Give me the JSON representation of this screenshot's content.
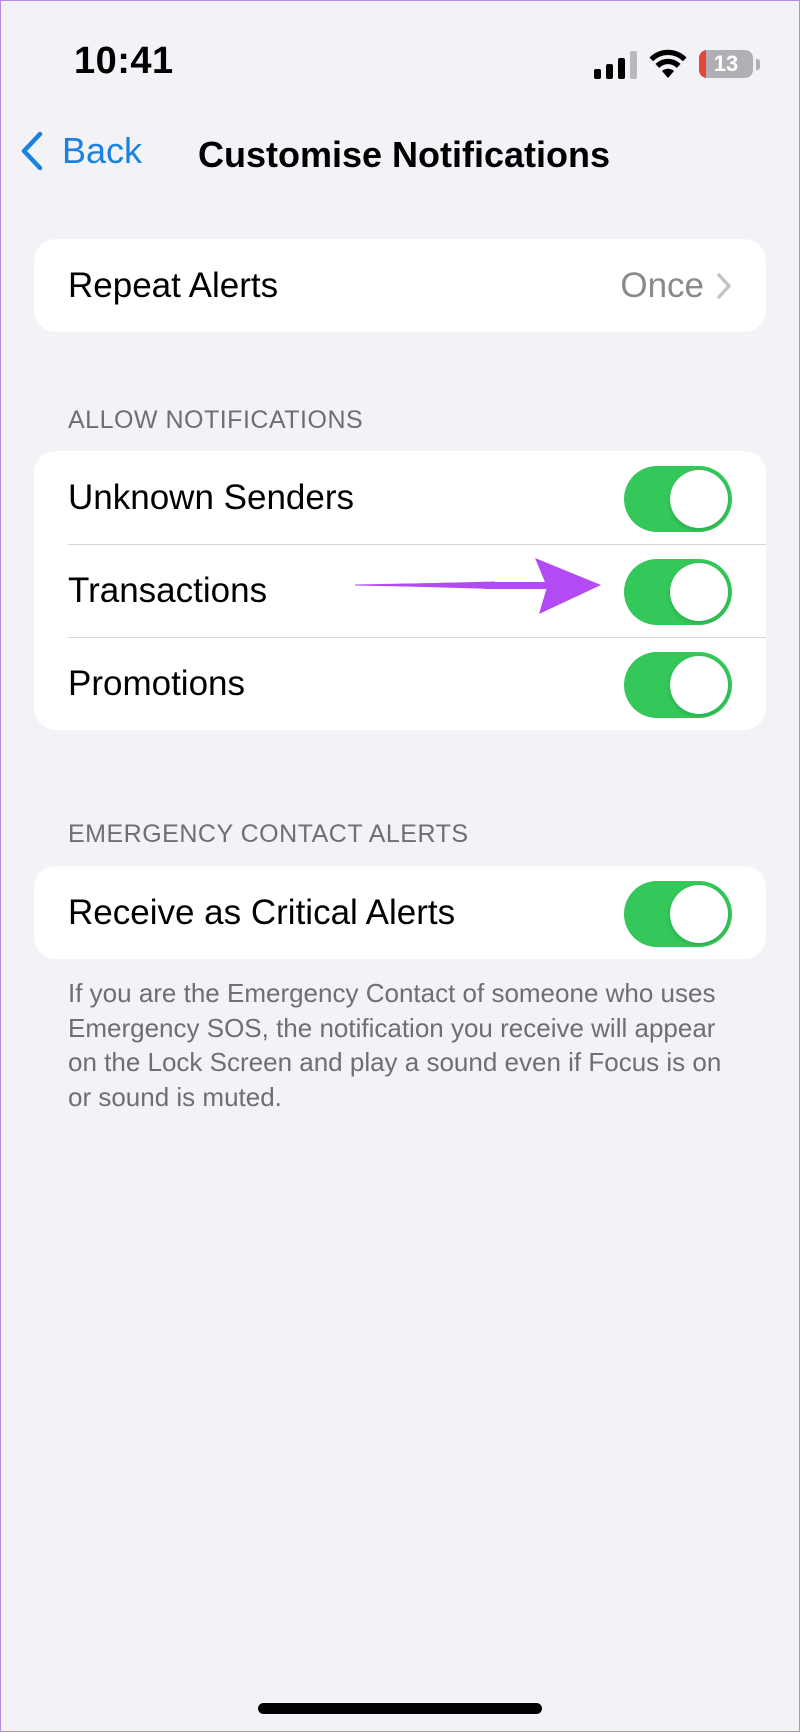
{
  "status_bar": {
    "time": "10:41",
    "battery_percent": "13",
    "battery_level": 0.13,
    "icons": [
      "cellular-signal-icon",
      "wifi-icon",
      "battery-icon"
    ]
  },
  "nav": {
    "back_label": "Back",
    "title": "Customise Notifications"
  },
  "repeat_alerts": {
    "label": "Repeat Alerts",
    "value": "Once"
  },
  "allow_notifications": {
    "header": "ALLOW NOTIFICATIONS",
    "items": [
      {
        "label": "Unknown Senders",
        "on": true
      },
      {
        "label": "Transactions",
        "on": true
      },
      {
        "label": "Promotions",
        "on": true
      }
    ]
  },
  "emergency": {
    "header": "EMERGENCY CONTACT ALERTS",
    "label": "Receive as Critical Alerts",
    "on": true,
    "footer": "If you are the Emergency Contact of someone who uses Emergency SOS, the notification you receive will appear on the Lock Screen and play a sound even if Focus is on or sound is muted."
  },
  "colors": {
    "accent": "#1a82e0",
    "toggle_on": "#34c759",
    "annotation_arrow": "#b24bf3",
    "background": "#f2f2f7"
  }
}
